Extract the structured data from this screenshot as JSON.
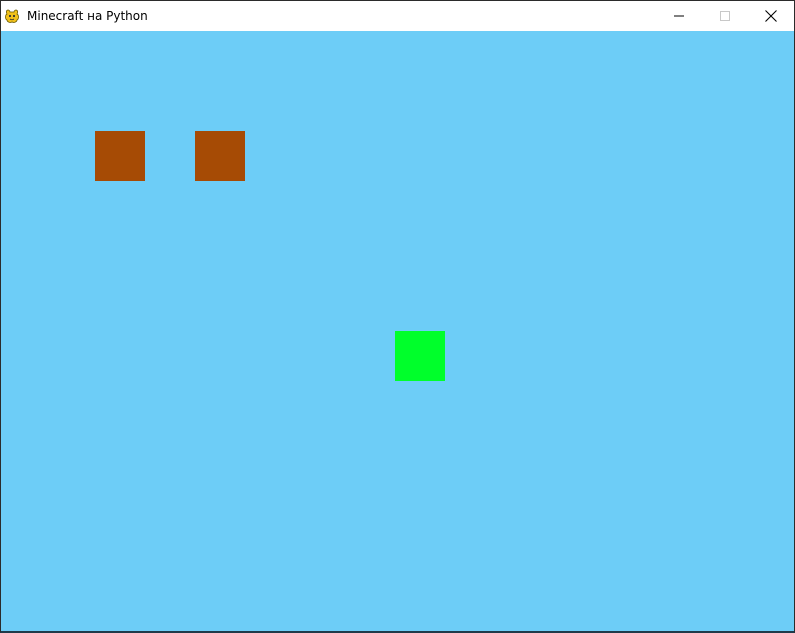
{
  "window": {
    "title": "Minecraft на Python",
    "icon": "pygame-snake-icon"
  },
  "controls": {
    "minimize_icon": "minimize-icon",
    "maximize_icon": "maximize-icon",
    "close_icon": "close-icon"
  },
  "colors": {
    "sky": "#6dcdf7",
    "dirt_block": "#a64b05",
    "grass_block": "#00ff2b"
  },
  "game": {
    "blocks": [
      {
        "kind": "dirt",
        "color": "#a64b05"
      },
      {
        "kind": "dirt",
        "color": "#a64b05"
      },
      {
        "kind": "player",
        "color": "#00ff2b"
      }
    ]
  }
}
